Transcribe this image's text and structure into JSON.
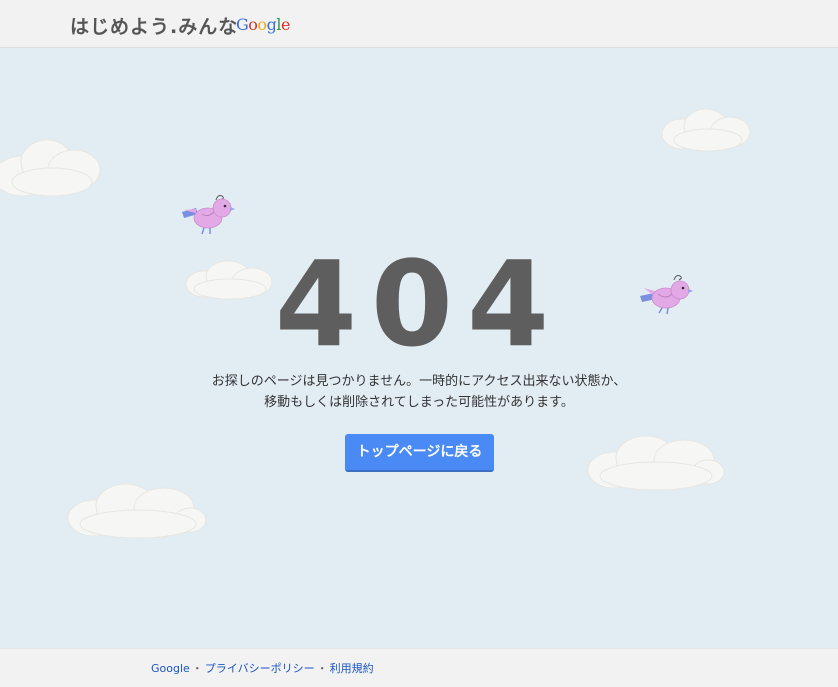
{
  "header": {
    "site_title": "はじめよう.みんな",
    "logo_letters": [
      {
        "char": "G",
        "color": "#3b6fd8"
      },
      {
        "char": "o",
        "color": "#d4342a"
      },
      {
        "char": "o",
        "color": "#e8ae1b"
      },
      {
        "char": "g",
        "color": "#3b6fd8"
      },
      {
        "char": "l",
        "color": "#2f9a46"
      },
      {
        "char": "e",
        "color": "#d4342a"
      }
    ]
  },
  "main": {
    "error_code": "404",
    "message_line1": "お探しのページは見つかりません。一時的にアクセス出来ない状態か、",
    "message_line2": "移動もしくは削除されてしまった可能性があります。",
    "button_label": "トップページに戻る"
  },
  "decorations": {
    "cloud_icon": "cloud-icon",
    "bird_icon": "bird-icon",
    "bird_color": "#e3a8e6",
    "cloud_color": "#f7f7f5"
  },
  "footer": {
    "links": [
      "Google",
      "プライバシーポリシー",
      "利用規約"
    ],
    "separator": "・"
  },
  "colors": {
    "background": "#e2ecf3",
    "header_bg": "#f2f2f2",
    "button_bg": "#4a8af4",
    "link": "#1a55c4"
  }
}
